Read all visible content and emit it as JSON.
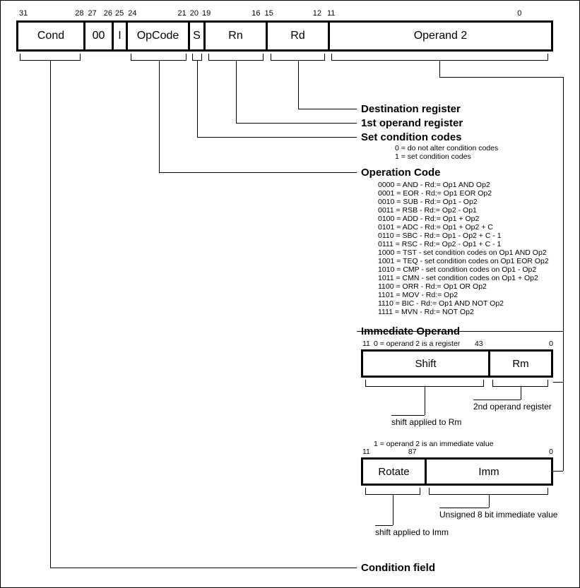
{
  "main_bits": {
    "b31": "31",
    "b28": "28",
    "b27": "27",
    "b26": "26",
    "b25": "25",
    "b24": "24",
    "b21": "21",
    "b20": "20",
    "b19": "19",
    "b16": "16",
    "b15": "15",
    "b12": "12",
    "b11": "11",
    "b0": "0"
  },
  "main_fields": {
    "cond": "Cond",
    "zeros": "00",
    "i": "I",
    "opcode": "OpCode",
    "s": "S",
    "rn": "Rn",
    "rd": "Rd",
    "op2": "Operand 2"
  },
  "headings": {
    "dest": "Destination register",
    "first": "1st operand register",
    "setcc": "Set condition codes",
    "opcode": "Operation Code",
    "immop": "Immediate Operand",
    "condfield": "Condition field"
  },
  "setcc_lines": "0 = do not alter condition codes\n1 = set condition codes",
  "opcode_lines": "0000 = AND - Rd:= Op1 AND Op2\n0001 = EOR - Rd:= Op1 EOR Op2\n0010 = SUB - Rd:= Op1 - Op2\n0011 = RSB - Rd:= Op2 - Op1\n0100 = ADD - Rd:= Op1 + Op2\n0101 = ADC - Rd:= Op1 + Op2 + C\n0110 = SBC - Rd:= Op1 - Op2 + C - 1\n0111 = RSC - Rd:= Op2 - Op1 + C - 1\n1000 = TST - set condition codes on Op1 AND Op2\n1001 = TEQ - set condition codes on Op1 EOR Op2\n1010 = CMP - set condition codes on Op1 - Op2\n1011 = CMN - set condition codes on Op1 + Op2\n1100 = ORR - Rd:= Op1 OR Op2\n1101 = MOV - Rd:= Op2\n1110 = BIC - Rd:= Op1 AND NOT Op2\n1111 = MVN - Rd:= NOT Op2",
  "imm_caption0": "0 = operand 2 is a register",
  "imm_caption1": "1 = operand 2 is an immediate value",
  "shift_bits": {
    "b11": "11",
    "b4": "4",
    "b3": "3",
    "b0": "0"
  },
  "shift_fields": {
    "shift": "Shift",
    "rm": "Rm"
  },
  "shift_labels": {
    "rm": "2nd operand register",
    "shift": "shift applied to Rm"
  },
  "rot_bits": {
    "b11": "11",
    "b8": "8",
    "b7": "7",
    "b0": "0"
  },
  "rot_fields": {
    "rotate": "Rotate",
    "imm": "Imm"
  },
  "rot_labels": {
    "imm": "Unsigned 8 bit immediate value",
    "rotate": "shift applied to Imm"
  }
}
